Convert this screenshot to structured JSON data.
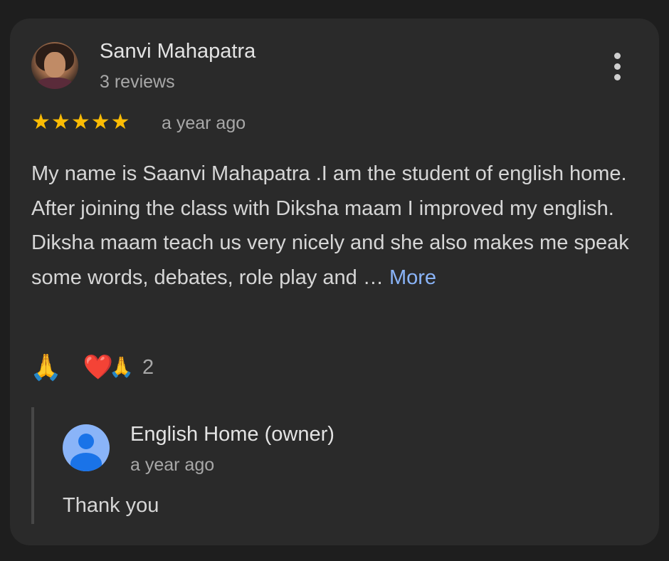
{
  "review": {
    "reviewer_name": "Sanvi Mahapatra",
    "review_count": "3 reviews",
    "rating": 5,
    "stars": [
      "★",
      "★",
      "★",
      "★",
      "★"
    ],
    "date": "a year ago",
    "text": "My name is Saanvi Mahapatra .I am the student of english home. After joining the class with Diksha maam I improved my english. Diksha maam teach us very nicely and she also makes me speak some words, debates, role play and … ",
    "more_label": "More",
    "star_color": "#fbbc04",
    "menu_icon": "more-vert-icon"
  },
  "reactions": {
    "own_reaction": "🙏",
    "summary_emojis": [
      "❤️",
      "🙏"
    ],
    "count": "2"
  },
  "owner_reply": {
    "name": "English Home (owner)",
    "date": "a year ago",
    "text": "Thank you",
    "avatar_icon": "person-icon"
  },
  "colors": {
    "background": "#1e1e1e",
    "card": "#2a2a2a",
    "link": "#8ab4f8"
  }
}
